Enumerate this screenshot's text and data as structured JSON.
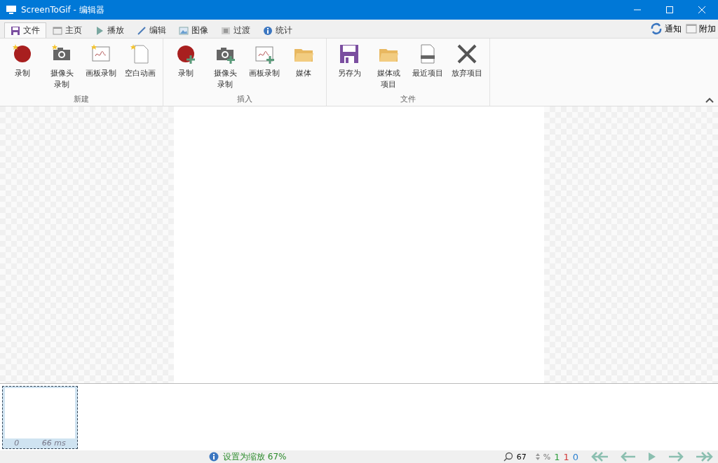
{
  "window": {
    "title": "ScreenToGif - 编辑器"
  },
  "tabs": [
    {
      "label": "文件",
      "kind": "save",
      "selected": true
    },
    {
      "label": "主页",
      "kind": "home",
      "selected": false
    },
    {
      "label": "播放",
      "kind": "play",
      "selected": false
    },
    {
      "label": "编辑",
      "kind": "edit",
      "selected": false
    },
    {
      "label": "图像",
      "kind": "image",
      "selected": false
    },
    {
      "label": "过渡",
      "kind": "transition",
      "selected": false
    },
    {
      "label": "统计",
      "kind": "info",
      "selected": false
    }
  ],
  "tab_extras": [
    {
      "label": "通知",
      "kind": "refresh"
    },
    {
      "label": "附加",
      "kind": "home"
    }
  ],
  "ribbon_groups": [
    {
      "name": "新建",
      "buttons": [
        {
          "lines": [
            "录制"
          ],
          "kind": "record"
        },
        {
          "lines": [
            "摄像头",
            "录制"
          ],
          "kind": "camera"
        },
        {
          "lines": [
            "画板录制"
          ],
          "kind": "board"
        },
        {
          "lines": [
            "空白动画"
          ],
          "kind": "blank"
        }
      ]
    },
    {
      "name": "插入",
      "buttons": [
        {
          "lines": [
            "录制"
          ],
          "kind": "record-add"
        },
        {
          "lines": [
            "摄像头",
            "录制"
          ],
          "kind": "camera-add"
        },
        {
          "lines": [
            "画板录制"
          ],
          "kind": "board-add"
        },
        {
          "lines": [
            "媒体"
          ],
          "kind": "media"
        }
      ]
    },
    {
      "name": "文件",
      "buttons": [
        {
          "lines": [
            "另存为"
          ],
          "kind": "save"
        },
        {
          "lines": [
            "媒体或",
            "项目"
          ],
          "kind": "media"
        },
        {
          "lines": [
            "最近项目"
          ],
          "kind": "recent"
        },
        {
          "lines": [
            "放弃项目"
          ],
          "kind": "discard"
        }
      ]
    }
  ],
  "frames": [
    {
      "index": "0",
      "delay": "66 ms",
      "selected": true
    }
  ],
  "status": {
    "message": "设置为缩放 67%",
    "zoom": "67",
    "percent": "%",
    "counts": [
      {
        "value": "1",
        "color": "#2e9e3e"
      },
      {
        "value": "1",
        "color": "#d23a3a"
      },
      {
        "value": "0",
        "color": "#2a7fd0"
      }
    ]
  }
}
